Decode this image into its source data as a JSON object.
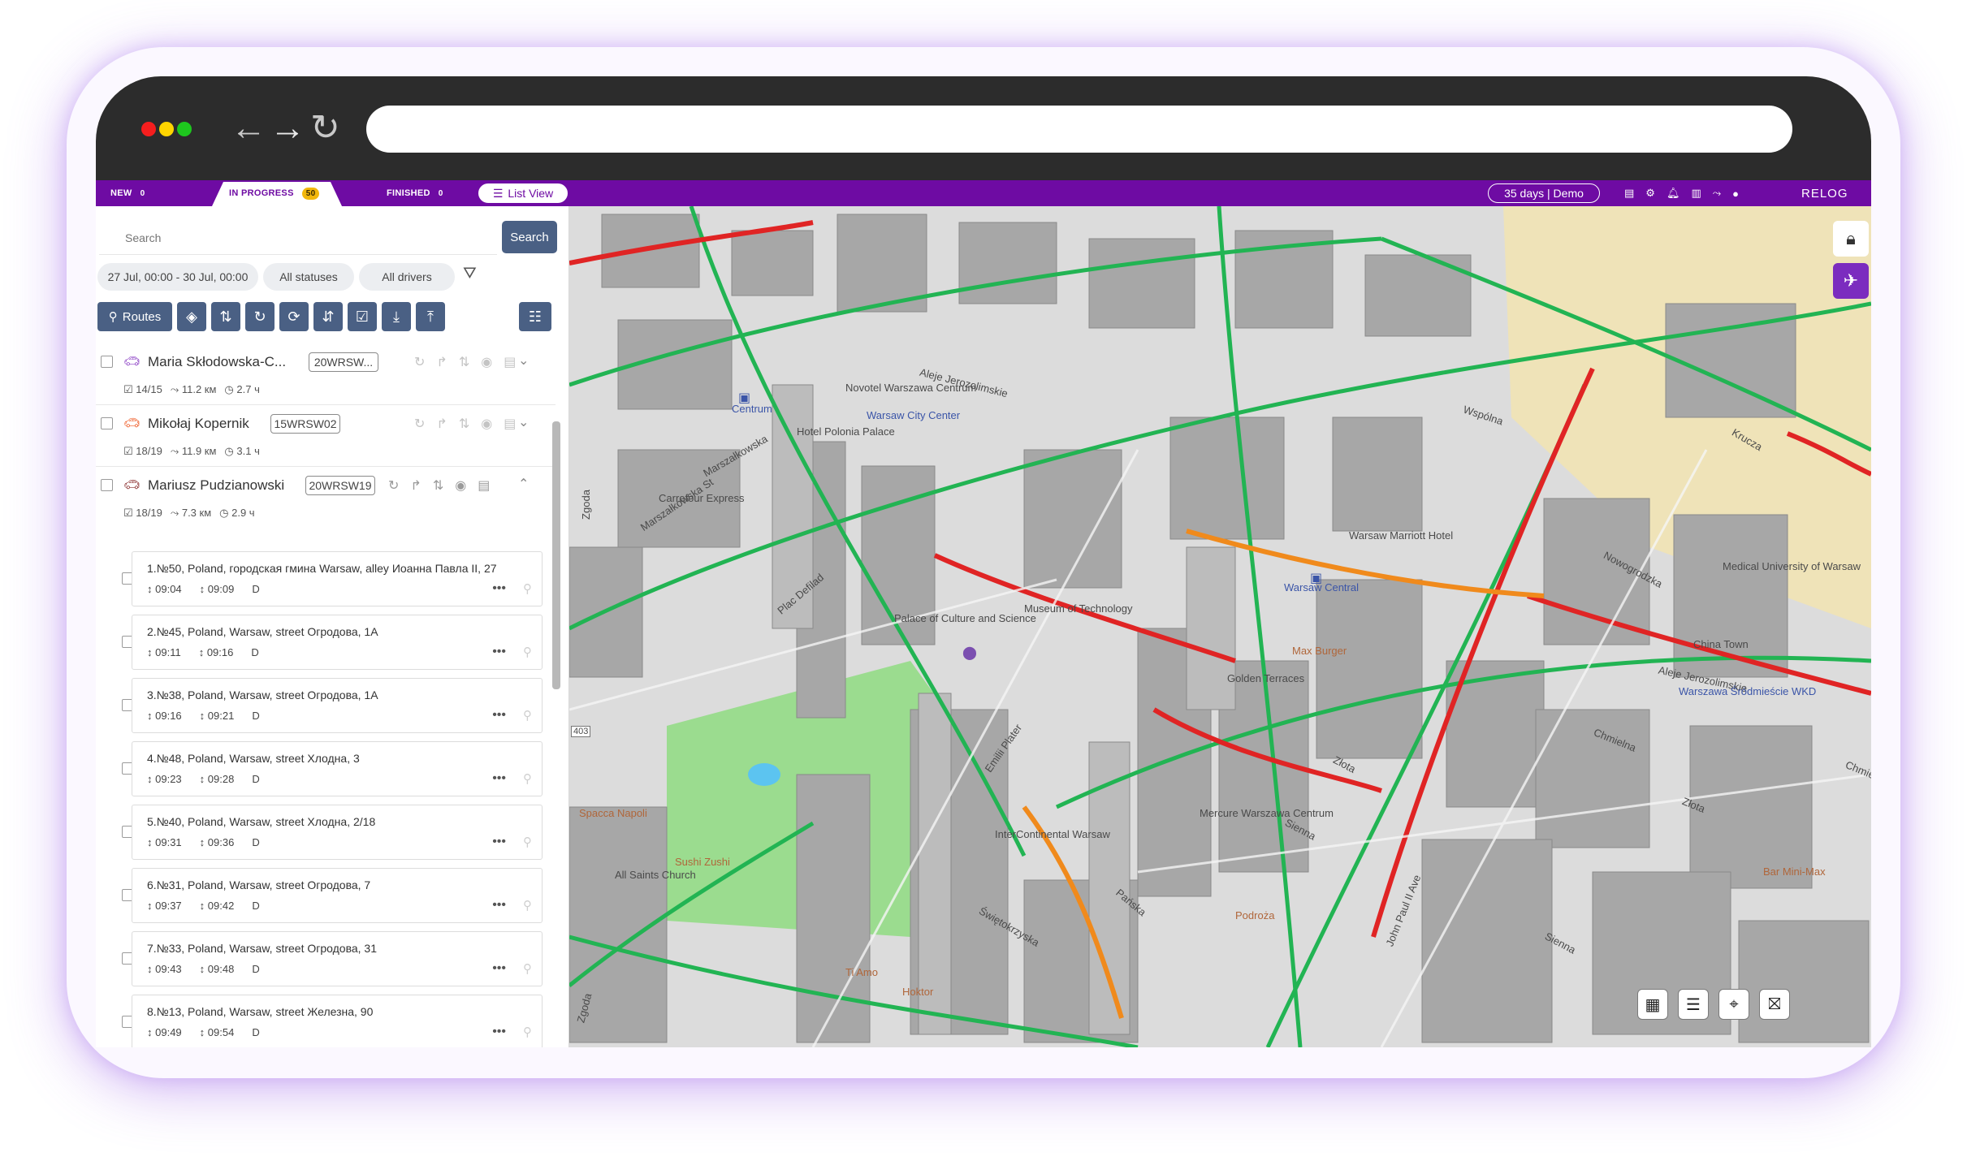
{
  "tabs": [
    {
      "label": "NEW",
      "count": "0"
    },
    {
      "label": "IN PROGRESS",
      "count": "50"
    },
    {
      "label": "FINISHED",
      "count": "0"
    }
  ],
  "list_view_label": "List View",
  "plan_label": "35 days | Demo",
  "logo": "RELOG",
  "search": {
    "placeholder": "Search",
    "button": "Search"
  },
  "filters": {
    "date_range": "27 Jul, 00:00 - 30 Jul, 00:00",
    "status": "All statuses",
    "drivers": "All drivers"
  },
  "toolbar": {
    "routes_label": "Routes"
  },
  "routes": [
    {
      "driver": "Maria Skłodowska-C...",
      "plate": "20WRSW...",
      "stops": "14/15",
      "distance": "11.2 км",
      "duration": "2.7 ч",
      "car_color": "#8b3fc4",
      "expanded": false
    },
    {
      "driver": "Mikołaj Kopernik",
      "plate": "15WRSW02",
      "stops": "18/19",
      "distance": "11.9 км",
      "duration": "3.1 ч",
      "car_color": "#ef5a24",
      "expanded": false
    },
    {
      "driver": "Mariusz Pudzianowski",
      "plate": "20WRSW19",
      "stops": "18/19",
      "distance": "7.3 км",
      "duration": "2.9 ч",
      "car_color": "#8a2d2d",
      "expanded": true
    }
  ],
  "stops": [
    {
      "address": "1.№50, Poland, городская гмина Warsaw, alley Иоанна Павла II, 27",
      "arrive": "09:04",
      "depart": "09:09",
      "type": "D"
    },
    {
      "address": "2.№45, Poland, Warsaw, street Огродова, 1A",
      "arrive": "09:11",
      "depart": "09:16",
      "type": "D"
    },
    {
      "address": "3.№38, Poland, Warsaw, street Огродова, 1A",
      "arrive": "09:16",
      "depart": "09:21",
      "type": "D"
    },
    {
      "address": "4.№48, Poland, Warsaw, street Хлодна, 3",
      "arrive": "09:23",
      "depart": "09:28",
      "type": "D"
    },
    {
      "address": "5.№40, Poland, Warsaw, street Хлодна, 2/18",
      "arrive": "09:31",
      "depart": "09:36",
      "type": "D"
    },
    {
      "address": "6.№31, Poland, Warsaw, street Огродова, 7",
      "arrive": "09:37",
      "depart": "09:42",
      "type": "D"
    },
    {
      "address": "7.№33, Poland, Warsaw, street Огродова, 31",
      "arrive": "09:43",
      "depart": "09:48",
      "type": "D"
    },
    {
      "address": "8.№13, Poland, Warsaw, street Железна, 90",
      "arrive": "09:49",
      "depart": "09:54",
      "type": "D"
    }
  ],
  "map_labels": {
    "centrum": "Centrum",
    "warsaw_city_center": "Warsaw City Center",
    "aleje_jerozolimskie": "Aleje Jerozolimskie",
    "aleje_jerozolimskie_2": "Aleje Jerozolimskie",
    "marszalkowska": "Marszałkowska",
    "marszalkowska_st": "Marszałkowska St",
    "warsaw_central": "Warsaw Central",
    "golden_terraces": "Golden Terraces",
    "max_burger": "Max Burger",
    "john_paul": "John Paul II Ave",
    "swietokrzyska": "Świętokrzyska",
    "all_saints": "All Saints Church",
    "bar_mini_max": "Bar Mini-Max",
    "warszawa_srodmiescie": "Warszawa Śródmieście WKD",
    "zlota": "Złota",
    "zlota_2": "Złota",
    "emilii_plater": "Emilii Plater",
    "chmielna": "Chmielna",
    "plac_defilad": "Plac Defilad",
    "museum_tech": "Museum of Technology",
    "palace_culture": "Palace of Culture and Science",
    "hotel_polonia": "Hotel Polonia Palace",
    "sienna": "Sienna",
    "sienna_2": "Sienna",
    "zgoda": "Zgoda",
    "zgoda_2": "Zgoda",
    "nowogrodzka": "Nowogrodzka",
    "krucza": "Krucza",
    "wspolna": "Wspólna",
    "pankska": "Pańska",
    "chmielna_2": "Chmielna",
    "road_number": "403",
    "podroza": "Podroża",
    "spaca_napoli": "Spacca Napoli",
    "sushi": "Sushi Zushi",
    "hoktor": "Hoktor",
    "warsaw_marriott": "Warsaw Marriott Hotel",
    "medical_university": "Medical University of Warsaw",
    "china_town": "China Town",
    "intercontinental": "InterContinental Warsaw",
    "mercure": "Mercure Warszawa Centrum",
    "novotel": "Novotel Warszawa Centrum",
    "carrefour": "Carrefour Express",
    "ti_amo": "Ti Amo"
  },
  "colors": {
    "brand_purple": "#6e0ba3",
    "button_slate": "#4a6084",
    "chat_yellow": "#f4b90f",
    "traffic_green": "#22b453",
    "traffic_red": "#e02424",
    "traffic_orange": "#f08a1c"
  },
  "map_controls": [
    "table-icon",
    "list-icon",
    "map-pin-icon",
    "route-map-icon"
  ]
}
